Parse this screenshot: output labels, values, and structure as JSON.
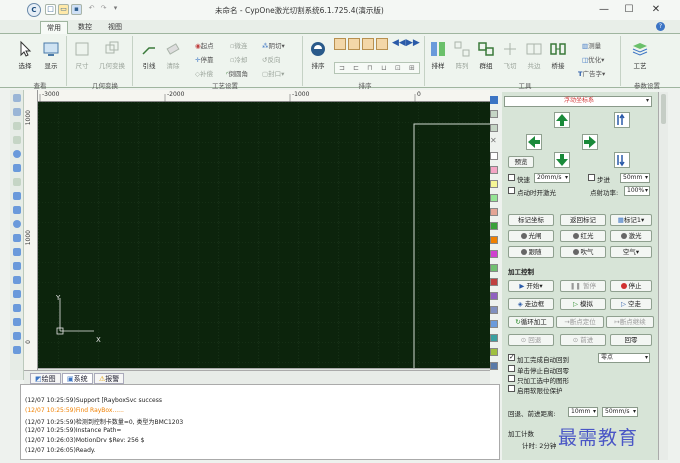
{
  "window": {
    "title": "未命名 - CypOne激光切割系统6.1.725.4(演示版)",
    "minimize_glyph": "—",
    "maximize_glyph": "☐",
    "close_glyph": "✕"
  },
  "tabs": [
    "常用",
    "数控",
    "视图"
  ],
  "ribbon": {
    "groups": [
      "查看",
      "几何变换",
      "工艺设置",
      "排序",
      "工具",
      "参数设置"
    ],
    "select": "选择",
    "display": "显示",
    "size": "尺寸",
    "geo_transform": "几何变换",
    "lead_line": "引线",
    "clear": "清除",
    "start_point": "起点",
    "micro_joint": "微连",
    "bridge": "阴切",
    "stop_point": "停靠",
    "cooling": "冷却",
    "reverse": "反向",
    "compensate": "补偿",
    "round_corner": "倒圆角",
    "seal": "封口",
    "sort": "排序",
    "layout": "排样",
    "array": "阵列",
    "group": "群组",
    "fly_cut": "飞切",
    "common_edge": "共边",
    "bridge_tool": "桥接",
    "measure": "测量",
    "optimize": "优化",
    "advertise_text": "广告字",
    "process": "工艺"
  },
  "rulers": {
    "h_labels": [
      "-3000",
      "-2000",
      "-1000",
      "0"
    ],
    "v_labels": [
      "1000",
      "1000",
      "0"
    ]
  },
  "canvas": {
    "axis_y": "Y",
    "axis_x": "X"
  },
  "bottom_tabs": [
    "绘图",
    "系统",
    "报警"
  ],
  "log": [
    "(12/07 10:25:59)Support [RayboxSvc success",
    "(12/07 10:25:59)Find RayBox......",
    "(12/07 10:25:59)检测到控制卡数量=0, 类型为BMC1203",
    "(12/07 10:25:59)Instance Path=",
    "(12/07 10:26:03)MotionDrv $Rev: 256 $",
    "(12/07 10:26:05)Ready."
  ],
  "panel": {
    "coord_system": "浮动坐标系",
    "preview": "预览",
    "fast": "快速",
    "fast_speed": "20mm/s",
    "step": "步进",
    "step_value": "50mm",
    "spot_laser": "点动时开激光",
    "spot_power_label": "点射功率:",
    "spot_power": "100%",
    "mark_coord": "标记坐标",
    "return_mark": "返回标记",
    "mark_one": "标记1",
    "light": "光闸",
    "red_light": "红光",
    "laser": "激光",
    "follow": "跟随",
    "blow": "吹气",
    "air": "空气",
    "section": "加工控制",
    "start": "开始",
    "pause": "暂停",
    "stop": "停止",
    "walk_border": "走边框",
    "simulate": "模拟",
    "dry_run": "空走",
    "loop": "循环加工",
    "break_locate": "断点定位",
    "break_continue": "断点继续",
    "back": "回退",
    "forward": "前进",
    "return_zero": "回零",
    "opt_return": "加工完成自动回到",
    "return_target": "零点",
    "opt_stop_return": "单击停止自动回零",
    "opt_selected": "只加工选中的图形",
    "opt_soft_limit": "启用软限位保护",
    "back_forward_label": "回退、前进距离:",
    "distance": "10mm",
    "distance_speed": "50mm/s",
    "counter": "加工计数",
    "counter_value": "计时: 2分钟"
  },
  "watermark": "最需教育"
}
